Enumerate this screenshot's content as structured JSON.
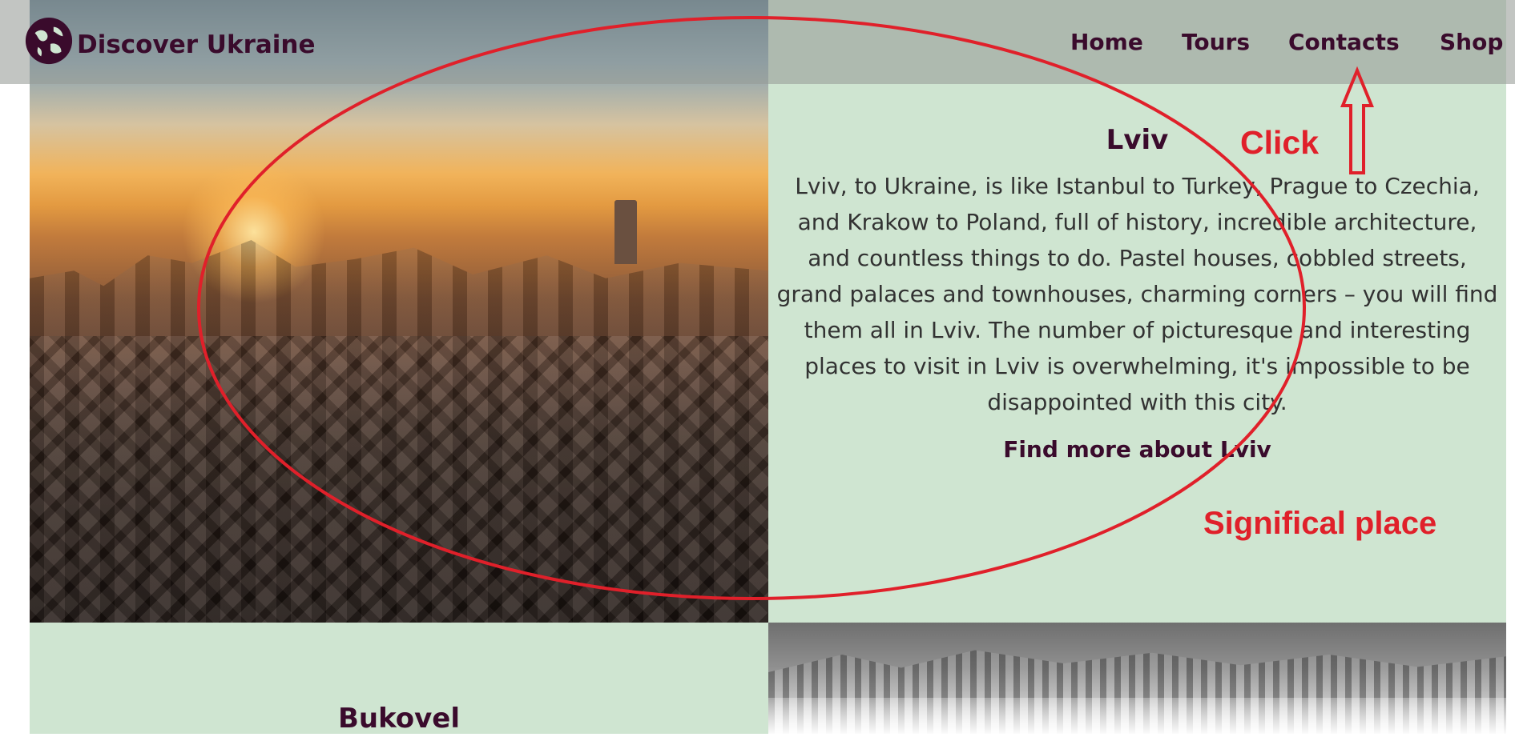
{
  "brand": {
    "name": "Discover Ukraine",
    "icon": "globe-icon"
  },
  "nav": {
    "items": [
      {
        "label": "Home"
      },
      {
        "label": "Tours"
      },
      {
        "label": "Contacts"
      },
      {
        "label": "Shop"
      }
    ]
  },
  "sections": {
    "lviv": {
      "title": "Lviv",
      "description": "Lviv, to Ukraine, is like Istanbul to Turkey, Prague to Czechia, and Krakow to Poland, full of history, incredible architecture, and countless things to do. Pastel houses, cobbled streets, grand palaces and townhouses, charming corners – you will find them all in Lviv. The number of picturesque and interesting places to visit in Lviv is overwhelming, it's impossible to be disappointed with this city.",
      "link": "Find more about Lviv"
    },
    "bukovel": {
      "title": "Bukovel"
    }
  },
  "annotations": {
    "click_label": "Click",
    "significal_label": "Significal place",
    "color": "#e0202a"
  },
  "colors": {
    "panel_bg": "#cfe5d1",
    "brand_text": "#3a0b2c",
    "body_text": "#323232"
  }
}
